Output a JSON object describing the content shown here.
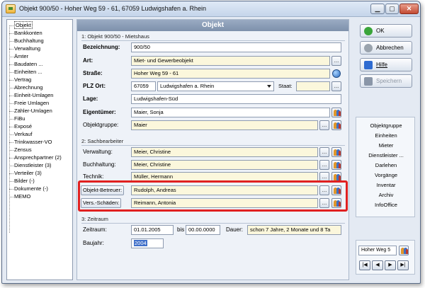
{
  "window": {
    "title": "Objekt 900/50 - Hoher Weg 59 - 61, 67059 Ludwigshafen a. Rhein",
    "minimize_icon": "minimize-icon",
    "maximize_icon": "maximize-icon",
    "close_icon": "close-icon"
  },
  "tree": {
    "items": [
      {
        "label": "Objekt"
      },
      {
        "label": "Bankkonten"
      },
      {
        "label": "Buchhaltung"
      },
      {
        "label": "Verwaltung"
      },
      {
        "label": "Ämter"
      },
      {
        "label": "Baudaten ..."
      },
      {
        "label": "Einheiten ..."
      },
      {
        "label": "Vertrag"
      },
      {
        "label": "Abrechnung"
      },
      {
        "label": "Einheit-Umlagen"
      },
      {
        "label": "Freie Umlagen"
      },
      {
        "label": "Zähler-Umlagen"
      },
      {
        "label": "FiBu"
      },
      {
        "label": "Exposé"
      },
      {
        "label": "Verkauf"
      },
      {
        "label": "Trinkwasser-VO"
      },
      {
        "label": "Zensus"
      },
      {
        "label": "Ansprechpartner (2)"
      },
      {
        "label": "Dienstleister (3)"
      },
      {
        "label": "Verteiler (3)"
      },
      {
        "label": "Bilder (-)"
      },
      {
        "label": "Dokumente (-)"
      },
      {
        "label": "MEMO"
      }
    ]
  },
  "main": {
    "header": "Objekt",
    "section1": {
      "title": "1: Objekt 900/50 - Mietshaus",
      "bezeichnung_label": "Bezeichnung:",
      "bezeichnung_value": "900/50",
      "art_label": "Art:",
      "art_value": "Miet- und Gewerbeobjekt",
      "strasse_label": "Straße:",
      "strasse_value": "Hoher Weg 59 - 61",
      "plz_label": "PLZ Ort:",
      "plz_value": "67059",
      "ort_value": "Ludwigshafen a. Rhein",
      "staat_label": "Staat:",
      "staat_value": "",
      "lage_label": "Lage:",
      "lage_value": "Ludwigshafen-Süd",
      "eigentuemer_label": "Eigentümer:",
      "eigentuemer_value": "Maier, Sonja",
      "objektgruppe_label": "Objektgruppe:",
      "objektgruppe_value": "Maier"
    },
    "section2": {
      "title": "2: Sachbearbeiter",
      "verwaltung_label": "Verwaltung:",
      "verwaltung_value": "Meier, Christine",
      "buchhaltung_label": "Buchhaltung:",
      "buchhaltung_value": "Meier, Christine",
      "technik_label": "Technik:",
      "technik_value": "Müller, Hermann",
      "betreuer_label": "Objekt-Betreuer:",
      "betreuer_value": "Rudolph, Andreas",
      "schaeden_label": "Vers.-Schäden:",
      "schaeden_value": "Reimann, Antonia"
    },
    "section3": {
      "title": "3: Zeitraum",
      "zeitraum_label": "Zeitraum:",
      "zeitraum_from": "01.01.2005",
      "bis_label": "bis",
      "zeitraum_to": "00.00.0000",
      "dauer_label": "Dauer:",
      "dauer_value": "schon 7 Jahre, 2 Monate und 8 Ta",
      "baujahr_label": "Baujahr:",
      "baujahr_value": "2004"
    },
    "ellipsis": "..."
  },
  "actions": {
    "ok": "OK",
    "abbrechen": "Abbrechen",
    "hilfe": "Hilfe",
    "speichern": "Speichern"
  },
  "nav": {
    "items": [
      "Objektgruppe",
      "Einheiten",
      "Mieter",
      "Dienstleister ...",
      "Darlehen",
      "Vorgänge",
      "Inventar",
      "Archiv",
      "InfoOffice"
    ]
  },
  "record": {
    "current": "Hoher Weg 5",
    "first": "|◀",
    "prev": "◀",
    "next": "▶",
    "last": "▶|"
  },
  "colors": {
    "highlight": "#e02020",
    "header": "#8a9db8",
    "yellow_field": "#fbf7dc"
  }
}
